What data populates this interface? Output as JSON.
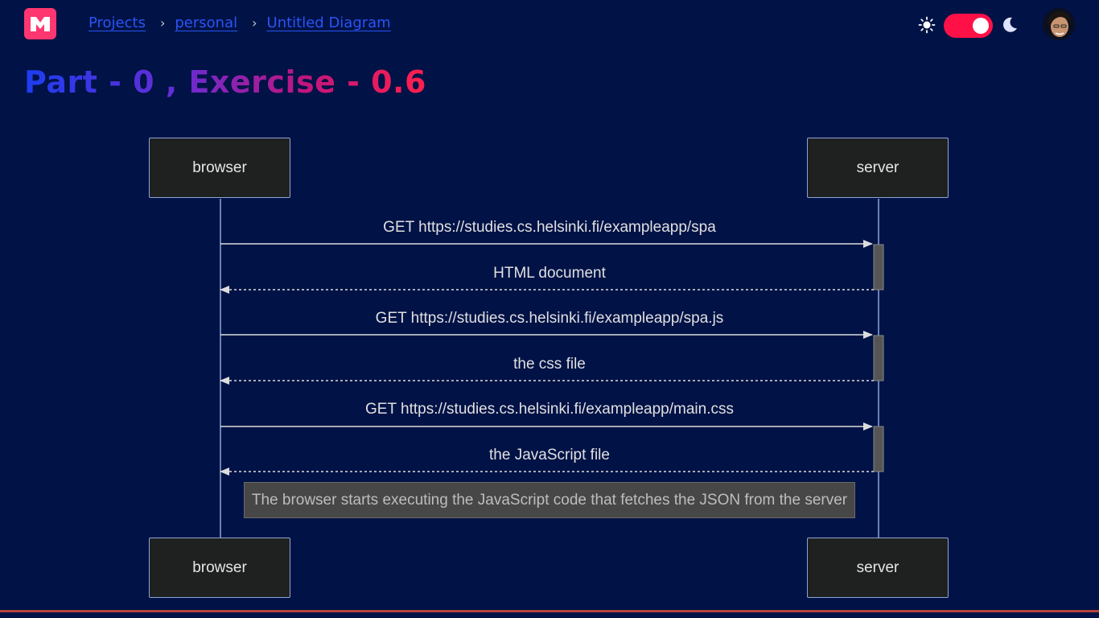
{
  "header": {
    "breadcrumb": [
      {
        "label": "Projects"
      },
      {
        "label": "personal"
      },
      {
        "label": "Untitled Diagram"
      }
    ],
    "separator": "›",
    "theme_toggle_state": "on"
  },
  "page": {
    "title": "Part - 0 , Exercise - 0.6"
  },
  "diagram": {
    "participants": [
      "browser",
      "server"
    ],
    "messages": [
      {
        "from": "browser",
        "to": "server",
        "style": "solid",
        "text": "GET https://studies.cs.helsinki.fi/exampleapp/spa"
      },
      {
        "from": "server",
        "to": "browser",
        "style": "dashed",
        "text": "HTML document"
      },
      {
        "from": "browser",
        "to": "server",
        "style": "solid",
        "text": "GET https://studies.cs.helsinki.fi/exampleapp/spa.js"
      },
      {
        "from": "server",
        "to": "browser",
        "style": "dashed",
        "text": "the css file"
      },
      {
        "from": "browser",
        "to": "server",
        "style": "solid",
        "text": "GET https://studies.cs.helsinki.fi/exampleapp/main.css"
      },
      {
        "from": "server",
        "to": "browser",
        "style": "dashed",
        "text": "the JavaScript file"
      }
    ],
    "note": "The browser starts executing the JavaScript code that fetches the JSON from the server"
  },
  "colors": {
    "background": "#001246",
    "accent": "#ff1148",
    "link": "#2b54f5"
  }
}
